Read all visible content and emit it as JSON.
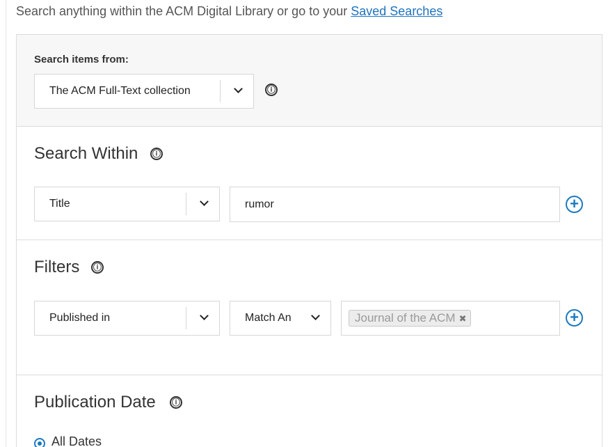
{
  "intro": {
    "text": "Search anything within the ACM Digital Library or go to your ",
    "link": "Saved Searches"
  },
  "search_from": {
    "label": "Search items from:",
    "selected": "The ACM Full-Text collection",
    "info_icon": "info-circle-icon"
  },
  "search_within": {
    "heading": "Search Within",
    "field": "Title",
    "term": "rumor",
    "add_icon": "plus-circle-icon"
  },
  "filters": {
    "heading": "Filters",
    "field": "Published in",
    "match": "Match An",
    "tag": "Journal of the ACM",
    "tag_remove": "✖",
    "add_icon": "plus-circle-icon"
  },
  "publication_date": {
    "heading": "Publication Date",
    "option": "All Dates"
  },
  "icons": {
    "info": "ⓘ",
    "plus": "+"
  },
  "colors": {
    "accent": "#1c79c0",
    "link": "#1e73be",
    "section_bg": "#f7f7f7"
  }
}
